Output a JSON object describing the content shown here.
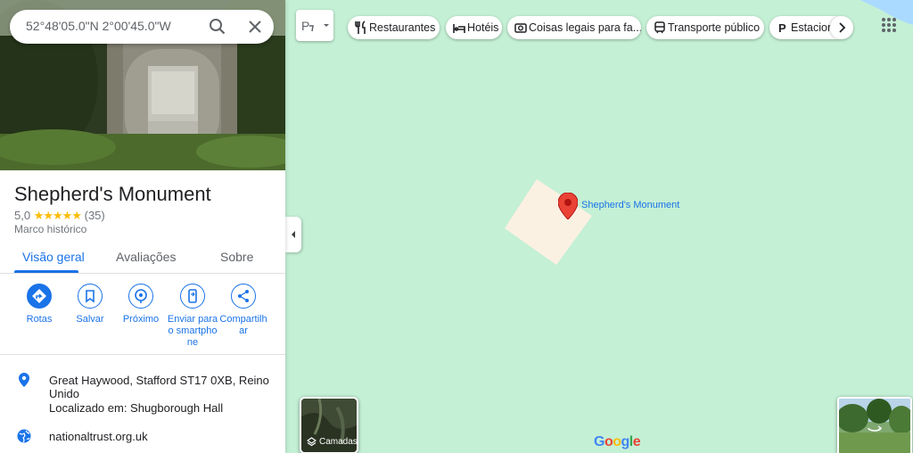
{
  "search": {
    "value": "52°48'05.0\"N 2°00'45.0\"W",
    "search_icon": "search-icon",
    "close_icon": "close-icon"
  },
  "place": {
    "name": "Shepherd's Monument",
    "rating": "5,0",
    "stars": "★★★★★",
    "review_count": "(35)",
    "category": "Marco histórico"
  },
  "tabs": [
    {
      "label": "Visão geral",
      "active": true
    },
    {
      "label": "Avaliações",
      "active": false
    },
    {
      "label": "Sobre",
      "active": false
    }
  ],
  "actions": [
    {
      "label": "Rotas",
      "icon": "directions-icon"
    },
    {
      "label": "Salvar",
      "icon": "bookmark-icon"
    },
    {
      "label": "Próximo",
      "icon": "nearby-icon"
    },
    {
      "label": "Enviar para o smartphone",
      "icon": "send-to-phone-icon"
    },
    {
      "label": "Compartilhar",
      "icon": "share-icon"
    }
  ],
  "info": {
    "address": "Great Haywood, Stafford ST17 0XB, Reino Unido",
    "located_in": "Localizado em: Shugborough Hall",
    "website": "nationaltrust.org.uk"
  },
  "chips": [
    {
      "label": "Restaurantes",
      "icon": "restaurant-icon"
    },
    {
      "label": "Hotéis",
      "icon": "hotel-icon"
    },
    {
      "label": "Coisas legais para fa...",
      "icon": "camera-icon"
    },
    {
      "label": "Transporte público",
      "icon": "transit-icon"
    },
    {
      "label": "Estacion",
      "icon": "parking-icon"
    }
  ],
  "map": {
    "place_label": "Shepherd's Monument",
    "layers_label": "Camadas",
    "logo": {
      "letters": [
        "G",
        "o",
        "o",
        "g",
        "l",
        "e"
      ],
      "colors": [
        "#4285f4",
        "#ea4335",
        "#fbbc04",
        "#4285f4",
        "#34a853",
        "#ea4335"
      ]
    }
  },
  "colors": {
    "accent": "#1a73e8",
    "map_bg": "#c4f0d5",
    "marker": "#ea4335",
    "building": "#fbf1e3"
  }
}
